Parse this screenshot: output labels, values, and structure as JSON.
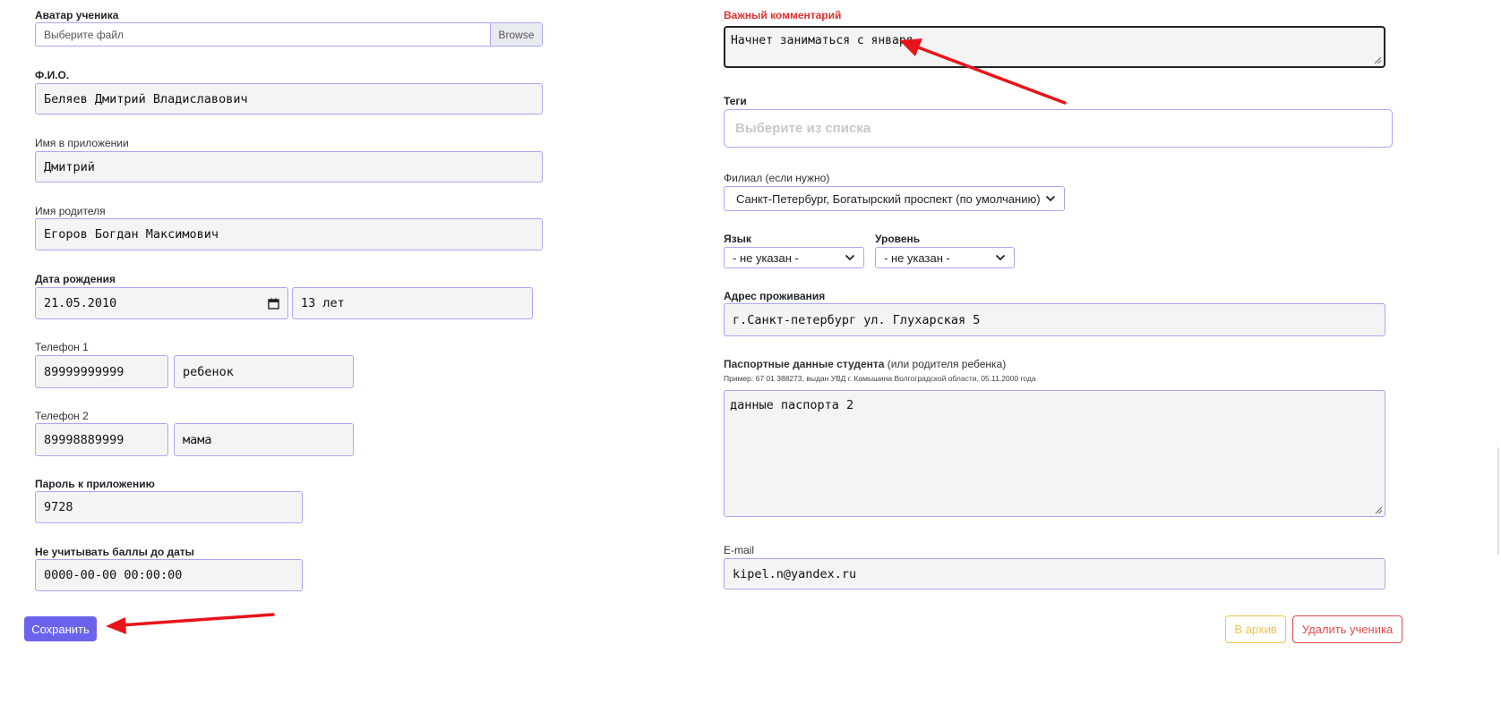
{
  "left": {
    "avatar": {
      "label": "Аватар ученика",
      "placeholder": "Выберите файл",
      "browse": "Browse"
    },
    "fio": {
      "label": "Ф.И.О.",
      "value": "Беляев Дмитрий Владиславович"
    },
    "app_name": {
      "label": "Имя в приложении",
      "value": "Дмитрий"
    },
    "parent_name": {
      "label": "Имя родителя",
      "value": "Егоров Богдан Максимович"
    },
    "birth": {
      "label": "Дата рождения",
      "value": "21.05.2010",
      "age": "13 лет"
    },
    "phone1": {
      "label": "Телефон 1",
      "number": "89999999999",
      "who": "ребенок"
    },
    "phone2": {
      "label": "Телефон 2",
      "number": "89998889999",
      "who": "мама"
    },
    "password": {
      "label": "Пароль к приложению",
      "value": "9728"
    },
    "ignore_points": {
      "label": "Не учитывать баллы до даты",
      "value": "0000-00-00 00:00:00"
    },
    "save_button": "Сохранить"
  },
  "right": {
    "comment": {
      "label": "Важный комментарий",
      "value": "Начнет заниматься с января"
    },
    "tags": {
      "label": "Теги",
      "placeholder": "Выберите из списка"
    },
    "branch": {
      "label": "Филиал (если нужно)",
      "selected": "Санкт-Петербург, Богатырский проспект (по умолчанию)"
    },
    "language": {
      "label": "Язык",
      "selected": "- не указан -"
    },
    "level": {
      "label": "Уровень",
      "selected": "- не указан -"
    },
    "address": {
      "label": "Адрес проживания",
      "value": "г.Санкт-петербург ул. Глухарская 5"
    },
    "passport": {
      "label_bold": "Паспортные данные студента",
      "label_rest": " (или родителя ребенка)",
      "hint": "Пример: 67 01 388273, выдан УВД г. Камышина Волгоградской области, 05.11.2000 года",
      "value": "данные паспорта 2"
    },
    "email": {
      "label": "E-mail",
      "value": "kipel.n@yandex.ru"
    },
    "archive_button": "В архив",
    "delete_button": "Удалить ученика"
  },
  "colors": {
    "accent": "#6c63ed",
    "field_border": "#aaa6f2",
    "field_bg": "#f4f4f4",
    "important_label": "#e03131",
    "arrow": "#e8141b",
    "archive": "#f2c14e",
    "delete": "#e34a4a"
  },
  "icons": [
    "calendar-icon",
    "chevron-down-icon",
    "resize-handle-icon",
    "arrow-annotation"
  ]
}
